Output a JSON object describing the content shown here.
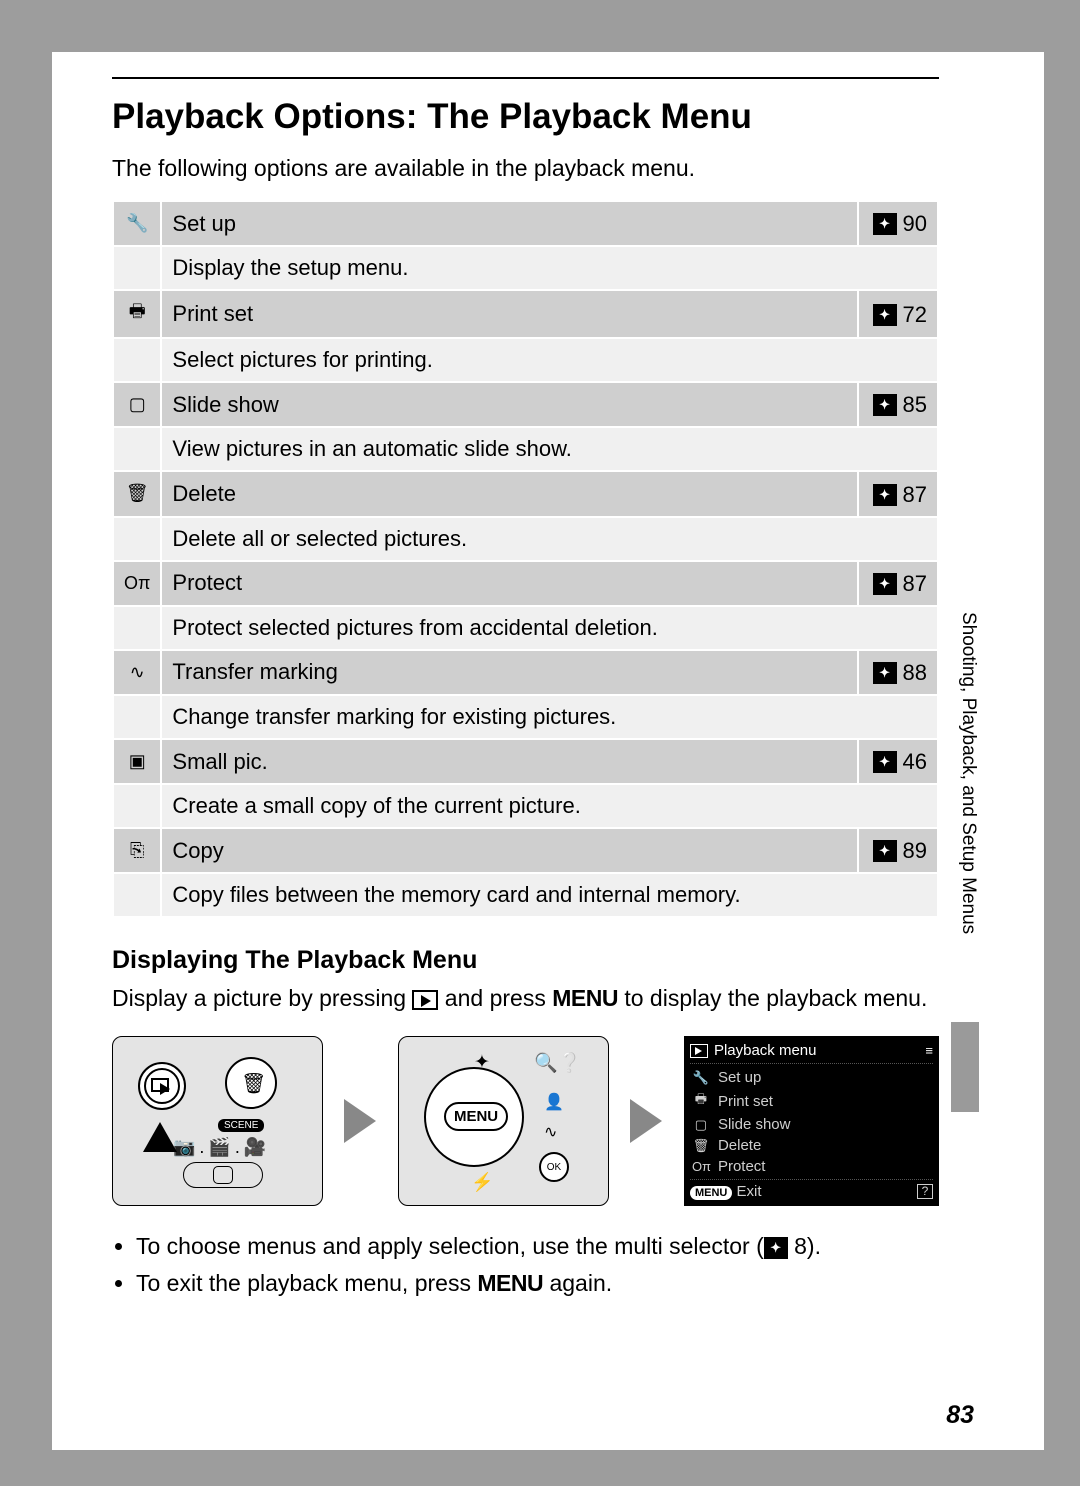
{
  "title": "Playback Options: The Playback Menu",
  "intro": "The following options are available in the playback menu.",
  "ref_glyph": "✦",
  "options": [
    {
      "icon": "🔧",
      "name": "Set up",
      "page": "90",
      "desc": "Display the setup menu."
    },
    {
      "icon": "🖶",
      "name": "Print set",
      "page": "72",
      "desc": "Select pictures for printing."
    },
    {
      "icon": "▢",
      "name": "Slide show",
      "page": "85",
      "desc": "View pictures in an automatic slide show."
    },
    {
      "icon": "🗑",
      "name": "Delete",
      "page": "87",
      "desc": "Delete all or selected pictures."
    },
    {
      "icon": "Oπ",
      "name": "Protect",
      "page": "87",
      "desc": "Protect selected pictures from accidental deletion."
    },
    {
      "icon": "∿",
      "name": "Transfer marking",
      "page": "88",
      "desc": "Change transfer marking for existing pictures."
    },
    {
      "icon": "▣",
      "name": "Small pic.",
      "page": "46",
      "desc": "Create a small copy of the current picture."
    },
    {
      "icon": "⎘",
      "name": "Copy",
      "page": "89",
      "desc": "Copy files between the memory card and internal memory."
    }
  ],
  "subhead": "Displaying The Playback Menu",
  "display_text_a": "Display a picture by pressing ",
  "display_text_b": " and press ",
  "display_text_c": " to display the playback menu.",
  "menu_word": "MENU",
  "lcd": {
    "title": "Playback menu",
    "items": [
      {
        "icon": "🔧",
        "label": "Set up"
      },
      {
        "icon": "🖶",
        "label": "Print set"
      },
      {
        "icon": "▢",
        "label": "Slide show"
      },
      {
        "icon": "🗑",
        "label": "Delete"
      },
      {
        "icon": "Oπ",
        "label": "Protect"
      }
    ],
    "footer_left": "MENU",
    "footer_exit": "Exit",
    "footer_right": "?"
  },
  "bullets_a": "To choose menus and apply selection, use the multi selector (",
  "bullets_a_page": "8",
  "bullets_a_end": ").",
  "bullets_b_a": "To exit the playback menu, press ",
  "bullets_b_b": " again.",
  "side_label": "Shooting, Playback, and Setup Menus",
  "page_number": "83",
  "scene_label": "SCENE",
  "ok_label": "OK"
}
